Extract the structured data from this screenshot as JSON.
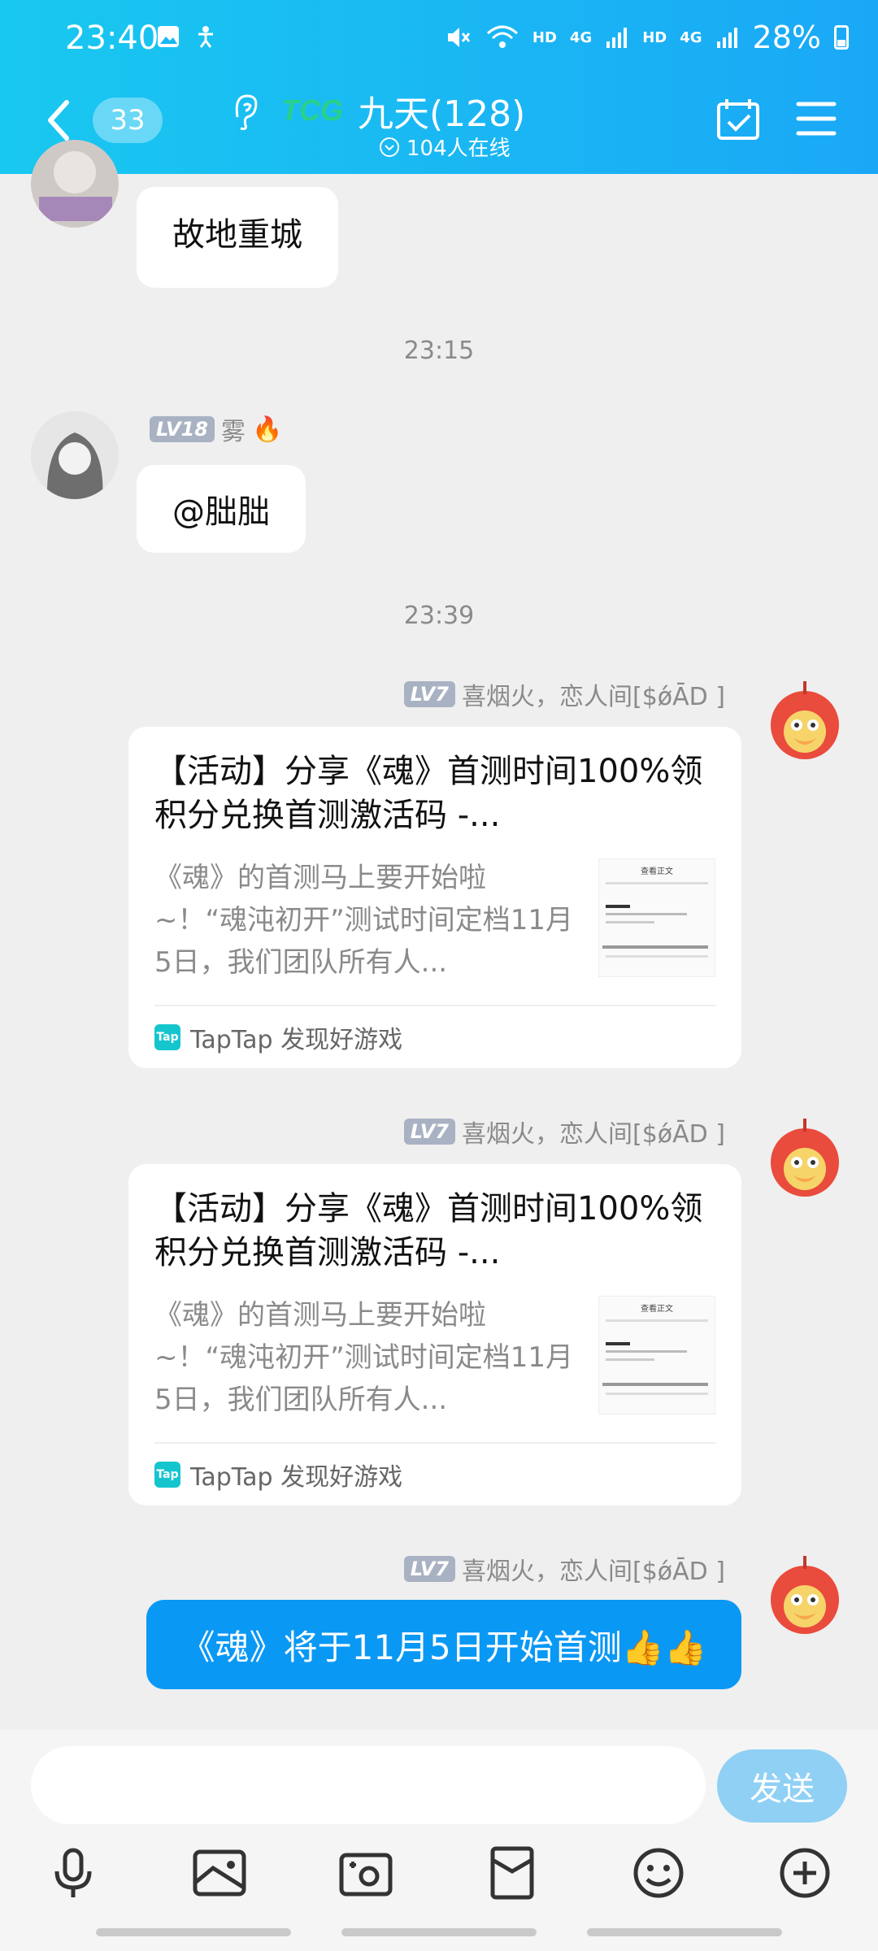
{
  "status_bar": {
    "time": "23:40",
    "network1": "HD",
    "network2": "4G",
    "network3": "HD",
    "network4": "4G",
    "battery": "28%"
  },
  "header": {
    "unread_count": "33",
    "title": "九天(128)",
    "online": "104人在线",
    "logo_text": "TCG"
  },
  "messages": [
    {
      "type": "image-text",
      "text": "故地重城"
    },
    {
      "type": "timestamp",
      "text": "23:15"
    },
    {
      "type": "text",
      "level": "LV18",
      "sender": "雾",
      "text": "@朏朏"
    },
    {
      "type": "timestamp",
      "text": "23:39"
    },
    {
      "type": "card",
      "level": "LV7",
      "sender": "喜烟火，恋人间[$ǿĀD ]",
      "title": "【活动】分享《魂》首测时间100%领积分兑换首测激活码 -...",
      "desc": "《魂》的首测马上要开始啦~！“魂沌初开”测试时间定档11月5日，我们团队所有人...",
      "source": "TapTap 发现好游戏"
    },
    {
      "type": "card",
      "level": "LV7",
      "sender": "喜烟火，恋人间[$ǿĀD ]",
      "title": "【活动】分享《魂》首测时间100%领积分兑换首测激活码 -...",
      "desc": "《魂》的首测马上要开始啦~！“魂沌初开”测试时间定档11月5日，我们团队所有人...",
      "source": "TapTap 发现好游戏"
    },
    {
      "type": "text-blue",
      "level": "LV7",
      "sender": "喜烟火，恋人间[$ǿĀD ]",
      "text": "《魂》将于11月5日开始首测👍👍"
    }
  ],
  "input": {
    "placeholder": "",
    "send_label": "发送"
  },
  "tap_icon_text": "Tap",
  "thumb_text": "查看正文"
}
